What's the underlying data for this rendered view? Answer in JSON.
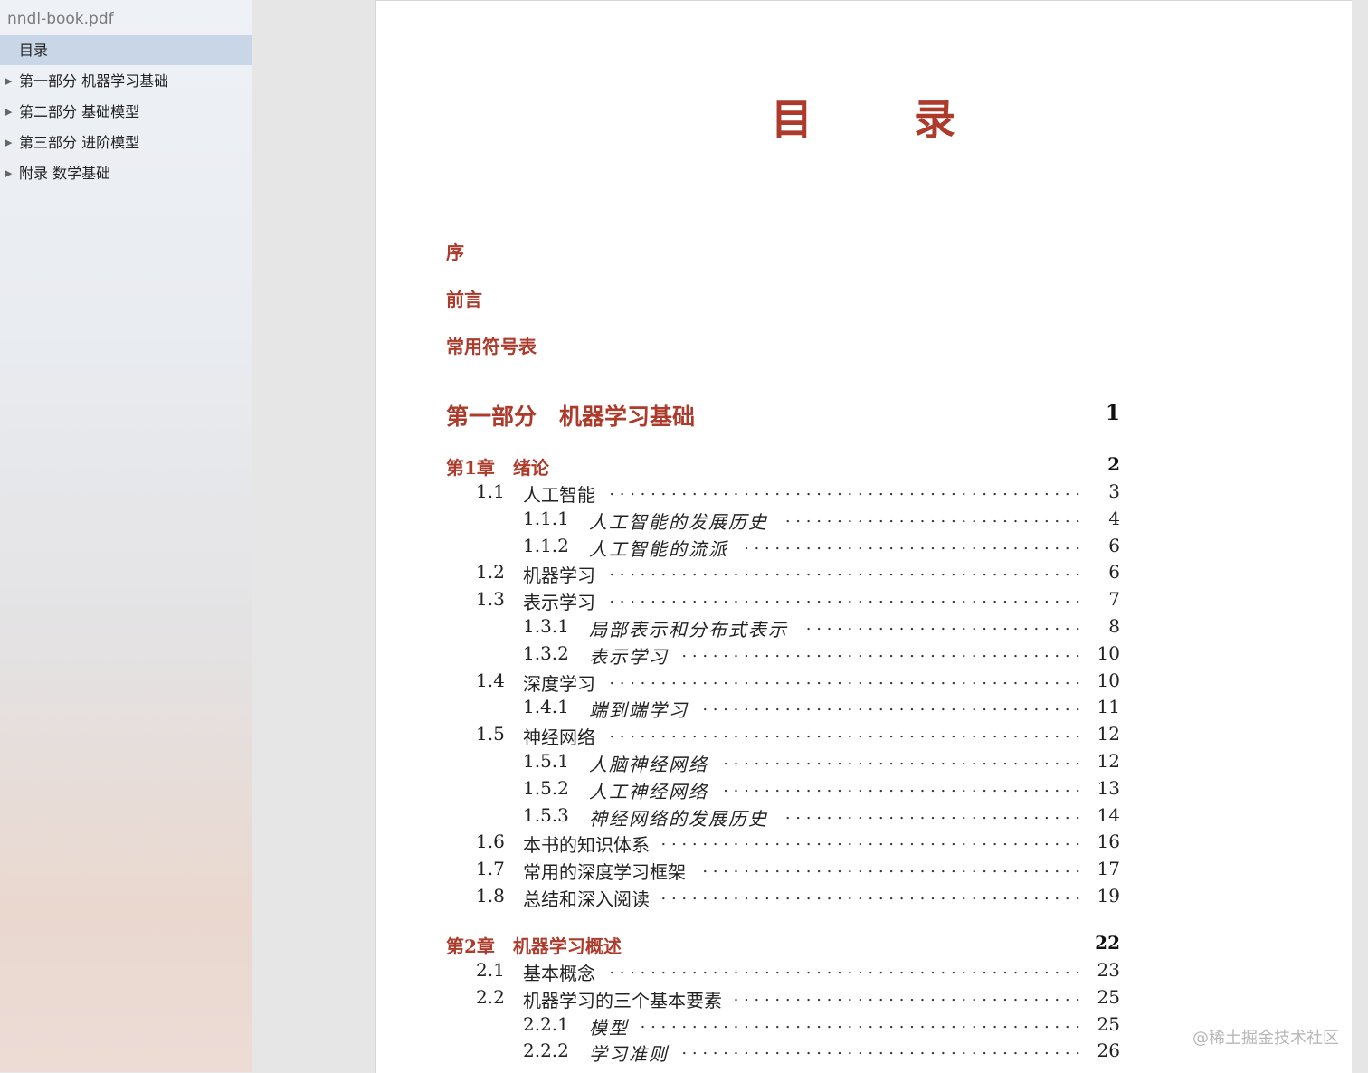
{
  "sidebar": {
    "file_name": "nndl-book.pdf",
    "items": [
      {
        "label": "目录",
        "has_arrow": false,
        "selected": true
      },
      {
        "label": "第一部分 机器学习基础",
        "has_arrow": true,
        "selected": false
      },
      {
        "label": "第二部分 基础模型",
        "has_arrow": true,
        "selected": false
      },
      {
        "label": "第三部分 进阶模型",
        "has_arrow": true,
        "selected": false
      },
      {
        "label": "附录  数学基础",
        "has_arrow": true,
        "selected": false
      }
    ]
  },
  "page": {
    "heading_left": "目",
    "heading_right": "录",
    "front_matter": [
      "序",
      "前言",
      "常用符号表"
    ],
    "part": {
      "title": "第一部分　机器学习基础",
      "page": "1"
    },
    "chapters": [
      {
        "title": "第1章　绪论",
        "page": "2",
        "entries": [
          {
            "num": "1.1",
            "title": "人工智能",
            "page": "3",
            "level": 1
          },
          {
            "num": "1.1.1",
            "title": "人工智能的发展历史",
            "page": "4",
            "level": 2
          },
          {
            "num": "1.1.2",
            "title": "人工智能的流派",
            "page": "6",
            "level": 2
          },
          {
            "num": "1.2",
            "title": "机器学习",
            "page": "6",
            "level": 1
          },
          {
            "num": "1.3",
            "title": "表示学习",
            "page": "7",
            "level": 1
          },
          {
            "num": "1.3.1",
            "title": "局部表示和分布式表示",
            "page": "8",
            "level": 2
          },
          {
            "num": "1.3.2",
            "title": "表示学习",
            "page": "10",
            "level": 2
          },
          {
            "num": "1.4",
            "title": "深度学习",
            "page": "10",
            "level": 1
          },
          {
            "num": "1.4.1",
            "title": "端到端学习",
            "page": "11",
            "level": 2
          },
          {
            "num": "1.5",
            "title": "神经网络",
            "page": "12",
            "level": 1
          },
          {
            "num": "1.5.1",
            "title": "人脑神经网络",
            "page": "12",
            "level": 2
          },
          {
            "num": "1.5.2",
            "title": "人工神经网络",
            "page": "13",
            "level": 2
          },
          {
            "num": "1.5.3",
            "title": "神经网络的发展历史",
            "page": "14",
            "level": 2
          },
          {
            "num": "1.6",
            "title": "本书的知识体系",
            "page": "16",
            "level": 1
          },
          {
            "num": "1.7",
            "title": "常用的深度学习框架",
            "page": "17",
            "level": 1
          },
          {
            "num": "1.8",
            "title": "总结和深入阅读",
            "page": "19",
            "level": 1
          }
        ]
      },
      {
        "title": "第2章　机器学习概述",
        "page": "22",
        "entries": [
          {
            "num": "2.1",
            "title": "基本概念",
            "page": "23",
            "level": 1
          },
          {
            "num": "2.2",
            "title": "机器学习的三个基本要素",
            "page": "25",
            "level": 1
          },
          {
            "num": "2.2.1",
            "title": "模型",
            "page": "25",
            "level": 2
          },
          {
            "num": "2.2.2",
            "title": "学习准则",
            "page": "26",
            "level": 2
          }
        ]
      }
    ]
  },
  "watermark": "@稀土掘金技术社区",
  "colors": {
    "accent": "#ad3b2c",
    "sidebar_selected": "#c9d6e7"
  }
}
